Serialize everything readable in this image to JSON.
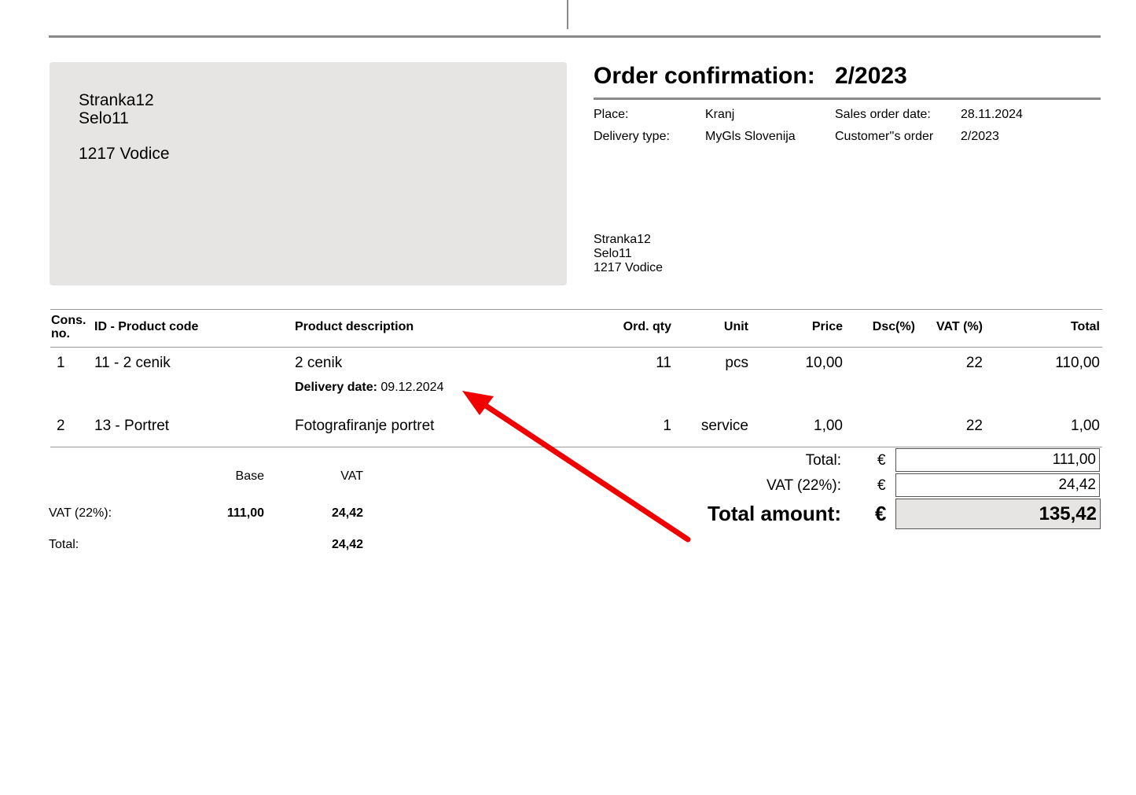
{
  "document": {
    "title_label": "Order confirmation:",
    "order_number": "2/2023"
  },
  "recipient": {
    "name": "Stranka12",
    "street": "Selo11",
    "city": "1217 Vodice"
  },
  "info": {
    "place_label": "Place:",
    "place_value": "Kranj",
    "sales_date_label": "Sales order date:",
    "sales_date_value": "28.11.2024",
    "delivery_type_label": "Delivery type:",
    "delivery_type_value": "MyGls Slovenija",
    "customer_order_label": "Customer''s order",
    "customer_order_value": "2/2023"
  },
  "delivery_address": {
    "name": "Stranka12",
    "street": "Selo11",
    "city": "1217 Vodice"
  },
  "table": {
    "headers": {
      "cons_no_line1": "Cons.",
      "cons_no_line2": "no.",
      "id_code": "ID - Product code",
      "description": "Product description",
      "qty": "Ord. qty",
      "unit": "Unit",
      "price": "Price",
      "discount": "Dsc(%)",
      "vat": "VAT (%)",
      "total": "Total"
    },
    "rows": [
      {
        "no": "1",
        "code": "11 - 2 cenik",
        "description": "2 cenik",
        "delivery_label": "Delivery date:",
        "delivery_value": "09.12.2024",
        "qty": "11",
        "unit": "pcs",
        "price": "10,00",
        "discount": "",
        "vat": "22",
        "total": "110,00"
      },
      {
        "no": "2",
        "code": "13 - Portret",
        "description": "Fotografiranje portret",
        "qty": "1",
        "unit": "service",
        "price": "1,00",
        "discount": "",
        "vat": "22",
        "total": "1,00"
      }
    ]
  },
  "vat_summary": {
    "base_header": "Base",
    "vat_header": "VAT",
    "row_label": "VAT (22%):",
    "row_base": "111,00",
    "row_vat": "24,42",
    "total_label": "Total:",
    "total_vat": "24,42"
  },
  "totals": {
    "currency": "€",
    "total_label": "Total:",
    "total_value": "111,00",
    "vat_label": "VAT (22%):",
    "vat_value": "24,42",
    "grand_label": "Total amount:",
    "grand_value": "135,42"
  },
  "colors": {
    "annotation_arrow": "#f00000",
    "panel_gray": "#e6e5e4"
  }
}
